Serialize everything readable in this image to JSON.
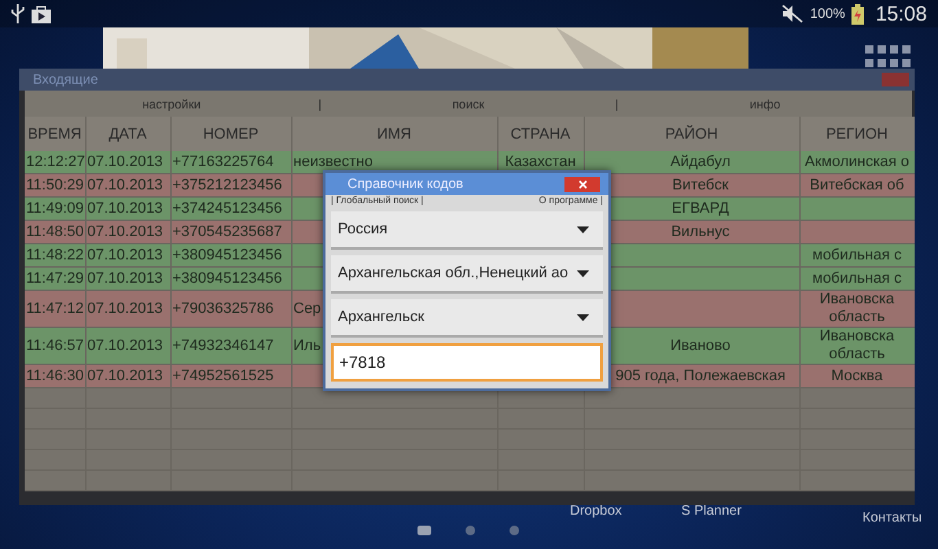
{
  "status_bar": {
    "battery_text": "100%",
    "time": "15:08"
  },
  "desktop": {
    "app_labels": [
      "Dropbox",
      "S Planner",
      "Контакты"
    ],
    "pages": [
      {
        "selected": true
      },
      {
        "selected": false
      },
      {
        "selected": false
      }
    ]
  },
  "window": {
    "title": "Входящие",
    "menu": [
      {
        "kind": "item",
        "label": "настройки"
      },
      {
        "kind": "separator",
        "label": "|"
      },
      {
        "kind": "item",
        "label": "поиск"
      },
      {
        "kind": "separator",
        "label": "|"
      },
      {
        "kind": "item",
        "label": "инфо"
      }
    ],
    "columns": [
      "ВРЕМЯ",
      "ДАТА",
      "НОМЕР",
      "ИМЯ",
      "СТРАНА",
      "РАЙОН",
      "РЕГИОН"
    ],
    "rows": [
      {
        "color": "#6c9468",
        "cells": [
          "12:12:27",
          "07.10.2013",
          "+77163225764",
          "неизвестно",
          "Казахстан",
          "Айдабул",
          "Акмолинская о"
        ]
      },
      {
        "color": "#9a716e",
        "cells": [
          "11:50:29",
          "07.10.2013",
          "+375212123456",
          "",
          "",
          "Витебск",
          "Витебская об"
        ]
      },
      {
        "color": "#6c9468",
        "cells": [
          "11:49:09",
          "07.10.2013",
          "+374245123456",
          "",
          "",
          "ЕГВАРД",
          ""
        ]
      },
      {
        "color": "#9a716e",
        "cells": [
          "11:48:50",
          "07.10.2013",
          "+370545235687",
          "",
          "",
          "Вильнус",
          ""
        ]
      },
      {
        "color": "#6c9468",
        "cells": [
          "11:48:22",
          "07.10.2013",
          "+380945123456",
          "",
          "",
          "",
          "мобильная с"
        ]
      },
      {
        "color": "#6c9468",
        "cells": [
          "11:47:29",
          "07.10.2013",
          "+380945123456",
          "",
          "",
          "",
          "мобильная с"
        ]
      },
      {
        "color": "#9a716e",
        "cells": [
          "11:47:12",
          "07.10.2013",
          "+79036325786",
          "Сер",
          "",
          "",
          "Ивановска область"
        ]
      },
      {
        "color": "#6c9468",
        "cells": [
          "11:46:57",
          "07.10.2013",
          "+74932346147",
          "Иль",
          "",
          "Иваново",
          "Ивановска область"
        ]
      },
      {
        "color": "#9a716e",
        "cells": [
          "11:46:30",
          "07.10.2013",
          "+74952561525",
          "",
          "",
          "905 года, Полежаевская",
          "Москва"
        ]
      }
    ]
  },
  "dialog": {
    "title": "Справочник кодов",
    "links": [
      "| Глобальный поиск |",
      "О программе  |"
    ],
    "spinners": [
      "Россия",
      "Архангельская обл.,Ненецкий ао",
      "Архангельск"
    ],
    "input": {
      "value": "+7818"
    }
  }
}
